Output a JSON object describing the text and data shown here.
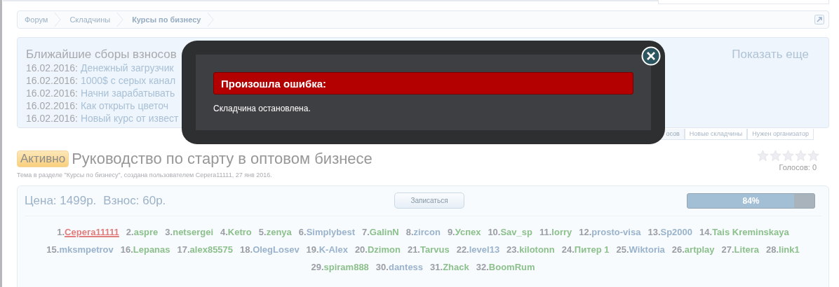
{
  "breadcrumbs": [
    {
      "label": "Форум",
      "current": false
    },
    {
      "label": "Складчины",
      "current": false
    },
    {
      "label": "Курсы по бизнесу",
      "current": true
    }
  ],
  "upcoming": {
    "title": "Ближайшие сборы взносов",
    "show_more": "Показать еще",
    "items": [
      {
        "date": "16.02.2016:",
        "title": "Денежный загрузчик"
      },
      {
        "date": "16.02.2016:",
        "title": "1000$ с серых канал"
      },
      {
        "date": "16.02.2016:",
        "title": "Начни зарабатывать"
      },
      {
        "date": "16.02.2016:",
        "title": "Как открыть цветоч"
      },
      {
        "date": "16.02.2016:",
        "title": "Новый курс от извест"
      }
    ],
    "tabs": [
      {
        "label": "осов",
        "selected": true
      },
      {
        "label": "Новые складчины",
        "selected": false
      },
      {
        "label": "Нужен организатор",
        "selected": false
      }
    ]
  },
  "thread": {
    "status": "Активно",
    "title": "Руководство по старту в оптовом бизнесе",
    "meta": "Тема в разделе \"Курсы по бизнесу\", создана пользователем Серега11111, 27 янв 2016.",
    "stars": 0,
    "votes": "Голосов: 0"
  },
  "deal": {
    "price": "Цена: 1499р.",
    "fee": "Взнос: 60р.",
    "join_button": "Записаться",
    "progress": {
      "level": 0.84,
      "reading": "84%"
    },
    "participants": [
      {
        "num": "1.",
        "name": "Серега11111",
        "color": "#e07d7d",
        "organizer": true
      },
      {
        "num": "2.",
        "name": "aspre",
        "color": "#8cc08c",
        "organizer": false
      },
      {
        "num": "3.",
        "name": "netsergei",
        "color": "#8cc08c",
        "organizer": false
      },
      {
        "num": "4.",
        "name": "Ketro",
        "color": "#8cc08c",
        "organizer": false
      },
      {
        "num": "5.",
        "name": "zenya",
        "color": "#8cc08c",
        "organizer": false
      },
      {
        "num": "6.",
        "name": "Simplybest",
        "color": "#9ab3cc",
        "organizer": false
      },
      {
        "num": "7.",
        "name": "GalinN",
        "color": "#8cc08c",
        "organizer": false
      },
      {
        "num": "8.",
        "name": "zircon",
        "color": "#9ab3cc",
        "organizer": false
      },
      {
        "num": "9.",
        "name": "Успех",
        "color": "#8cc08c",
        "organizer": false
      },
      {
        "num": "10.",
        "name": "Sav_sp",
        "color": "#8cc08c",
        "organizer": false
      },
      {
        "num": "11.",
        "name": "lorry",
        "color": "#8cc08c",
        "organizer": false
      },
      {
        "num": "12.",
        "name": "prosto-visa",
        "color": "#9ab3cc",
        "organizer": false
      },
      {
        "num": "13.",
        "name": "Sp2000",
        "color": "#9ab3cc",
        "organizer": false
      },
      {
        "num": "14.",
        "name": "Tais Kreminskaya",
        "color": "#8cc08c",
        "organizer": false
      },
      {
        "num": "15.",
        "name": "mksmpetrov",
        "color": "#9ab3cc",
        "organizer": false
      },
      {
        "num": "16.",
        "name": "Lepanas",
        "color": "#8cc08c",
        "organizer": false
      },
      {
        "num": "17.",
        "name": "alex85575",
        "color": "#8cc08c",
        "organizer": false
      },
      {
        "num": "18.",
        "name": "OlegLosev",
        "color": "#9ab3cc",
        "organizer": false
      },
      {
        "num": "19.",
        "name": "K-Alex",
        "color": "#9ab3cc",
        "organizer": false
      },
      {
        "num": "20.",
        "name": "Dzimon",
        "color": "#8cc08c",
        "organizer": false
      },
      {
        "num": "21.",
        "name": "Tarvus",
        "color": "#8cc08c",
        "organizer": false
      },
      {
        "num": "22.",
        "name": "level13",
        "color": "#9ab3cc",
        "organizer": false
      },
      {
        "num": "23.",
        "name": "kilotonn",
        "color": "#8cc08c",
        "organizer": false
      },
      {
        "num": "24.",
        "name": "Питер 1",
        "color": "#8cc08c",
        "organizer": false
      },
      {
        "num": "25.",
        "name": "Wiktoria",
        "color": "#9ab3cc",
        "organizer": false
      },
      {
        "num": "26.",
        "name": "artplay",
        "color": "#8cc08c",
        "organizer": false
      },
      {
        "num": "27.",
        "name": "Litera",
        "color": "#8cc08c",
        "organizer": false
      },
      {
        "num": "28.",
        "name": "link1",
        "color": "#8cc08c",
        "organizer": false
      },
      {
        "num": "29.",
        "name": "spiram888",
        "color": "#8cc08c",
        "organizer": false
      },
      {
        "num": "30.",
        "name": "dantess",
        "color": "#9ab3cc",
        "organizer": false
      },
      {
        "num": "31.",
        "name": "Zhack",
        "color": "#8cc08c",
        "organizer": false
      },
      {
        "num": "32.",
        "name": "BoomRum",
        "color": "#8cc08c",
        "organizer": false
      }
    ]
  },
  "dialog": {
    "heading": "Произошла ошибка:",
    "message": "Складчина остановлена."
  }
}
